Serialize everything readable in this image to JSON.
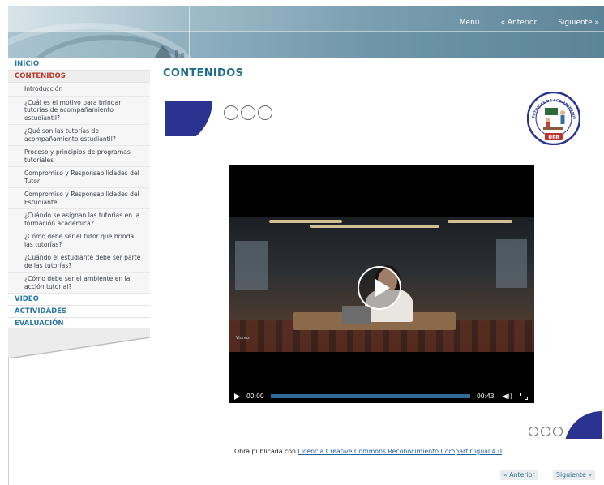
{
  "nav": {
    "menu": "Menú",
    "prev": "« Anterior",
    "next": "Siguiente »"
  },
  "sidebar": {
    "items": [
      {
        "label": "INICIO"
      },
      {
        "label": "CONTENIDOS"
      },
      {
        "label": "VIDEO"
      },
      {
        "label": "ACTIVIDADES"
      },
      {
        "label": "EVALUACIÓN"
      }
    ],
    "subitems": [
      "Introducción",
      "¿Cuál es el motivo para brindar tutorías de acompañamiento estudiantil?",
      "¿Qué son las tutorías de acompañamiento estudiantil?",
      "Proceso y principios de programas tutoriales",
      "Compromiso y Responsabilidades del Tutor",
      "Compromiso y Responsabilidades del Estudiante",
      "¿Cuándo se asignan las tutorías en la formación académica?",
      "¿Cómo debe ser el tutor que brinda las tutorías?",
      "¿Cuándo el estudiante debe ser parte de las tutorías?",
      "¿Cómo debe ser el ambiente en la acción tutorial?"
    ]
  },
  "main": {
    "title": "CONTENIDOS"
  },
  "logo": {
    "arc_text": "TUTORÍAS DE ACOMPAÑAMIENTO ESTUDIANTIL",
    "bottom": "UEB"
  },
  "video": {
    "brand": "Vidnoz",
    "current": "00:00",
    "duration": "00:43",
    "volume_glyph": "◀))"
  },
  "footer": {
    "license_prefix": "Obra publicada con",
    "license_link": "Licencia Creative Commons Reconocimiento Compartir igual 4.0",
    "prev": "« Anterior",
    "next": "Siguiente »"
  },
  "colors": {
    "accent": "#1f6f8b",
    "deco": "#2a3490",
    "link": "#2a78a8",
    "active": "#b83a2c"
  }
}
